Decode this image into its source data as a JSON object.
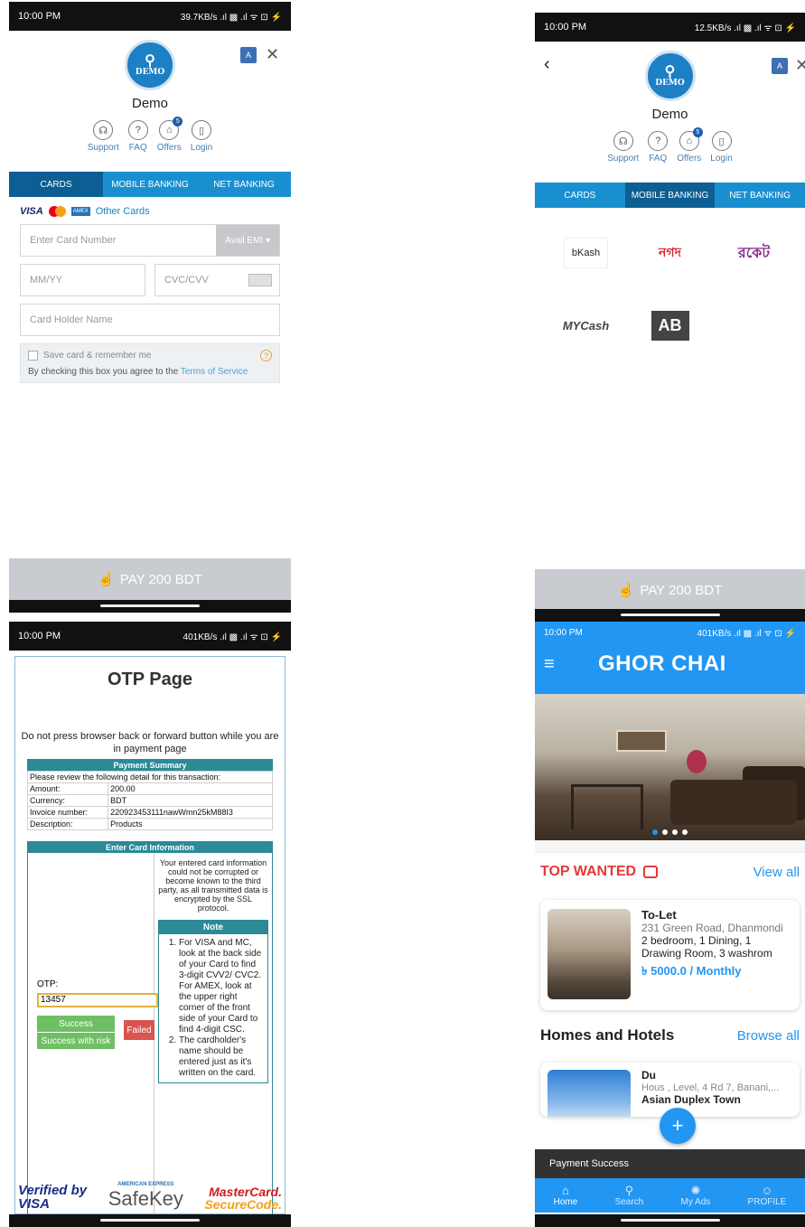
{
  "panel_card": {
    "status": {
      "time": "10:00 PM",
      "right": "39.7KB/s .ıl ▩ .ıl ᯤ ⊡ ⚡"
    },
    "logo_text": "DEMO",
    "merchant": "Demo",
    "tools": [
      {
        "label": "Support",
        "icon": "headset-icon"
      },
      {
        "label": "FAQ",
        "icon": "question-icon"
      },
      {
        "label": "Offers",
        "icon": "gift-icon",
        "badge": "5"
      },
      {
        "label": "Login",
        "icon": "login-icon"
      }
    ],
    "tabs": [
      "CARDS",
      "MOBILE BANKING",
      "NET BANKING"
    ],
    "active_tab": "CARDS",
    "brands": {
      "visa": "VISA",
      "other": "Other Cards"
    },
    "card_number_placeholder": "Enter Card Number",
    "emi_label": "Avail EMI ▾",
    "expiry_placeholder": "MM/YY",
    "cvc_placeholder": "CVC/CVV",
    "holder_placeholder": "Card Holder Name",
    "save_label": "Save card & remember me",
    "terms_prefix": "By checking this box you agree to the",
    "terms_link": "Terms of Service",
    "pay_label": "PAY 200 BDT"
  },
  "panel_mobile": {
    "status": {
      "time": "10:00 PM",
      "right": "12.5KB/s .ıl ▩ .ıl ᯤ ⊡ ⚡"
    },
    "back": "‹",
    "logo_text": "DEMO",
    "merchant": "Demo",
    "tools": [
      {
        "label": "Support"
      },
      {
        "label": "FAQ"
      },
      {
        "label": "Offers",
        "badge": "5"
      },
      {
        "label": "Login"
      }
    ],
    "tabs": [
      "CARDS",
      "MOBILE BANKING",
      "NET BANKING"
    ],
    "active_tab": "MOBILE BANKING",
    "providers": [
      "bKash",
      "নগদ",
      "রকেট",
      "MYCash",
      "AB"
    ],
    "pay_label": "PAY 200 BDT"
  },
  "panel_otp": {
    "status": {
      "time": "10:00 PM",
      "right": "401KB/s .ıl ▩ .ıl ᯤ ⊡ ⚡"
    },
    "title": "OTP Page",
    "warning": "Do not press browser back or forward button while you are in payment page",
    "summary_header": "Payment Summary",
    "summary_intro": "Please review the following detail for this transaction:",
    "summary_rows": [
      {
        "label": "Amount:",
        "value": "200.00"
      },
      {
        "label": "Currency:",
        "value": "BDT"
      },
      {
        "label": "Invoice number:",
        "value": "220923453111nawWmn25kM88I3"
      },
      {
        "label": "Description:",
        "value": "Products"
      }
    ],
    "card_info_header": "Enter Card Information",
    "security_text": "Your entered card information could not be corrupted or become known to the third party, as all transmitted data is encrypted by the SSL protocol.",
    "note_header": "Note",
    "notes": [
      "For VISA and MC, look at the back side of your Card to find 3-digit CVV2/ CVC2. For AMEX, look at the upper right corner of the front side of your Card to find 4-digit CSC.",
      "The cardholder's name should be entered just as it's written on the card."
    ],
    "otp_label": "OTP:",
    "otp_value": "13457",
    "btn_success": "Success",
    "btn_success_risk": "Success with risk",
    "btn_failed": "Failed",
    "verified_by": "Verified by",
    "visa": "VISA",
    "amex_top": "AMERICAN EXPRESS",
    "safekey": "SafeKey",
    "mastercard": "MasterCard.",
    "securecode": "SecureCode."
  },
  "panel_app": {
    "status": {
      "time": "10:00 PM",
      "right": "401KB/s .ıl ▩ .ıl ᯤ ⊡ ⚡"
    },
    "app_title": "GHOR CHAI",
    "top_wanted": "TOP WANTED",
    "view_all": "View all",
    "listing": {
      "type": "To-Let",
      "address": "231 Green Road, Dhanmondi",
      "rooms": "2 bedroom, 1 Dining, 1 Drawing Room, 3 washrom",
      "price": "৳ 5000.0 / Monthly"
    },
    "homes_title": "Homes and Hotels",
    "browse_all": "Browse all",
    "hotel": {
      "name": "Du",
      "address": "Hous      , Level, 4 Rd 7, Banani,...",
      "sub": "Asian Duplex Town"
    },
    "fab": "+",
    "snackbar": "Payment Success",
    "nav": [
      {
        "label": "Home",
        "icon": "home-icon"
      },
      {
        "label": "Search",
        "icon": "search-icon"
      },
      {
        "label": "My Ads",
        "icon": "ads-icon"
      },
      {
        "label": "PROFILE",
        "icon": "profile-icon"
      }
    ],
    "colors": {
      "primary": "#2196f3",
      "accent_red": "#e53935"
    }
  }
}
